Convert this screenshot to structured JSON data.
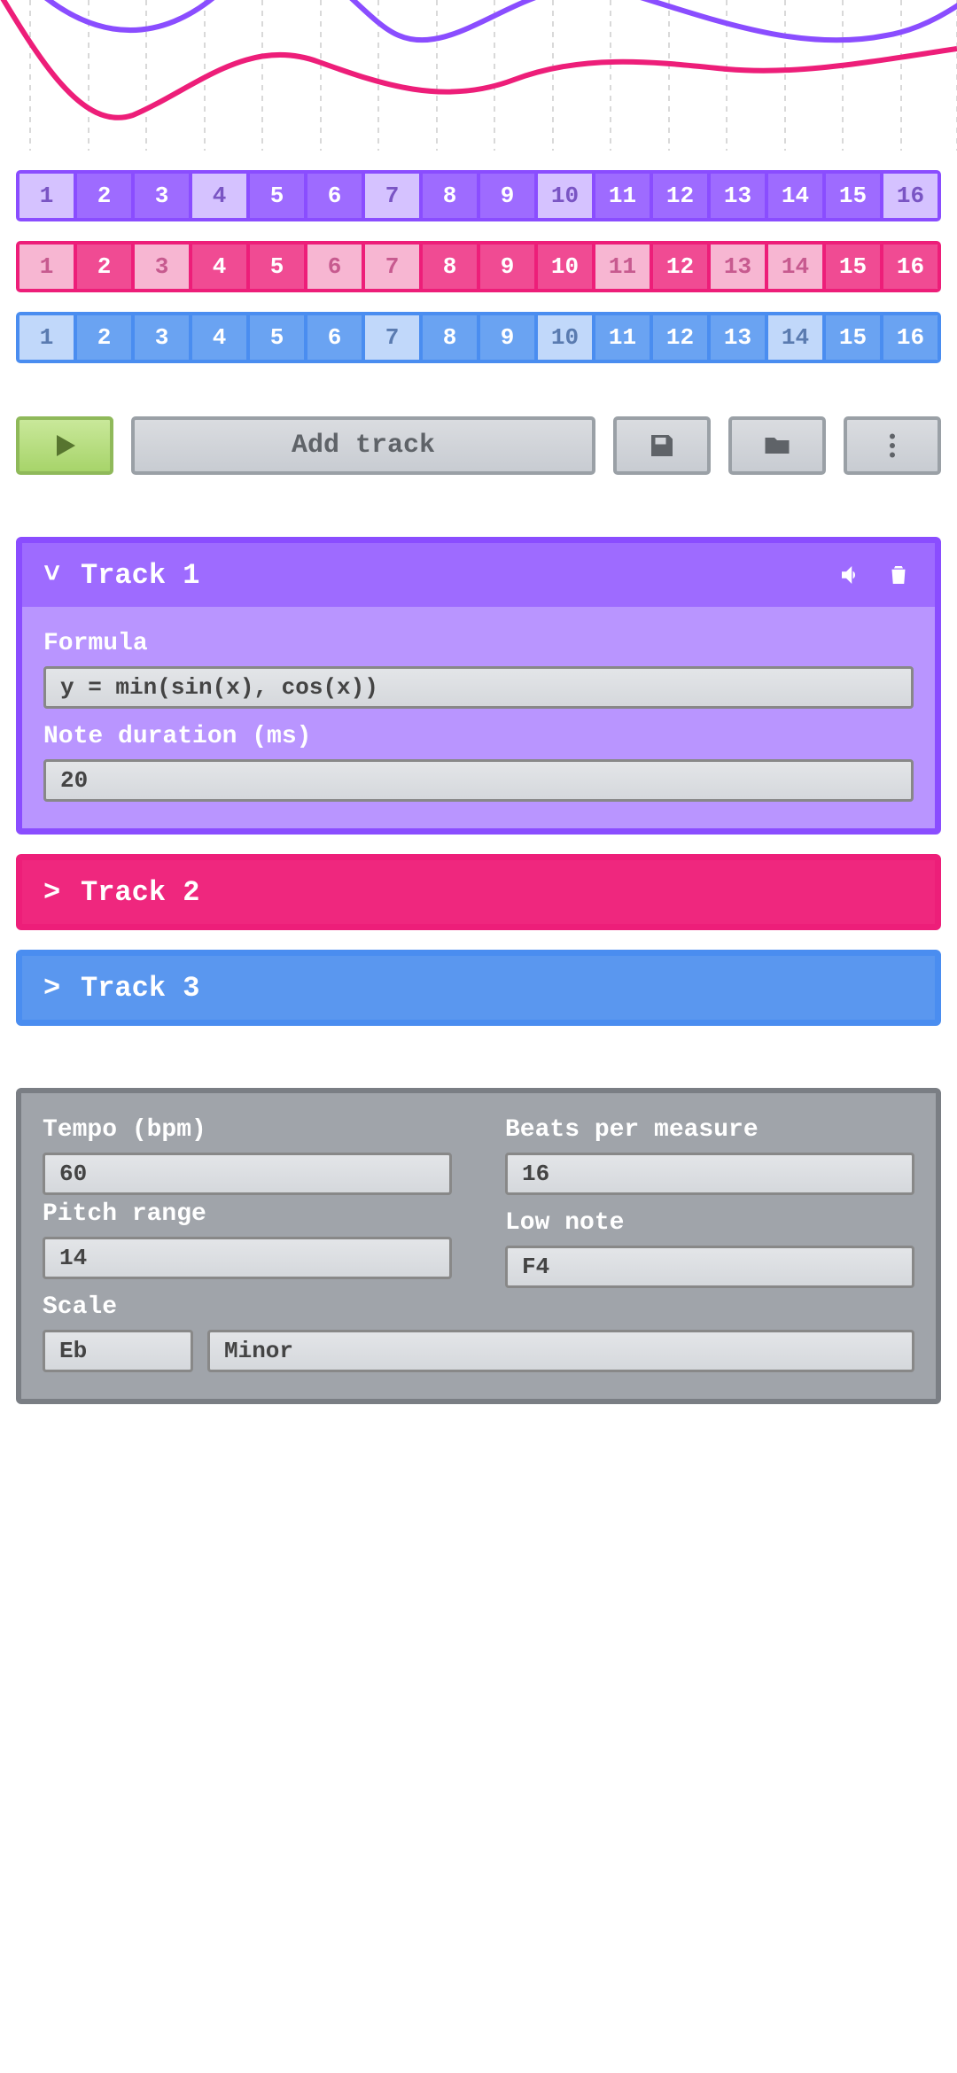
{
  "beat_rows": [
    {
      "color": "purple",
      "steps": [
        0,
        1,
        1,
        0,
        1,
        1,
        0,
        1,
        1,
        0,
        1,
        1,
        1,
        1,
        1,
        0
      ]
    },
    {
      "color": "pink",
      "steps": [
        0,
        1,
        0,
        1,
        1,
        0,
        0,
        1,
        1,
        1,
        0,
        1,
        0,
        0,
        1,
        1
      ]
    },
    {
      "color": "blue",
      "steps": [
        0,
        1,
        1,
        1,
        1,
        1,
        0,
        1,
        1,
        0,
        1,
        1,
        1,
        0,
        1,
        1
      ]
    }
  ],
  "beat_labels": [
    "1",
    "2",
    "3",
    "4",
    "5",
    "6",
    "7",
    "8",
    "9",
    "10",
    "11",
    "12",
    "13",
    "14",
    "15",
    "16"
  ],
  "toolbar": {
    "add_track_label": "Add track"
  },
  "tracks": [
    {
      "color": "purple",
      "expanded": true,
      "chevron": "˅",
      "title": "Track 1",
      "formula_label": "Formula",
      "formula_value": "y = min(sin(x), cos(x))",
      "duration_label": "Note duration (ms)",
      "duration_value": "20"
    },
    {
      "color": "pink",
      "expanded": false,
      "chevron": ">",
      "title": "Track 2"
    },
    {
      "color": "blue",
      "expanded": false,
      "chevron": ">",
      "title": "Track 3"
    }
  ],
  "settings": {
    "tempo_label": "Tempo (bpm)",
    "tempo_value": "60",
    "bpm_label": "Beats per measure",
    "bpm_value": "16",
    "pitch_label": "Pitch range",
    "pitch_value": "14",
    "lownote_label": "Low note",
    "lownote_value": "F4",
    "scale_label": "Scale",
    "scale_key": "Eb",
    "scale_mode": "Minor"
  }
}
